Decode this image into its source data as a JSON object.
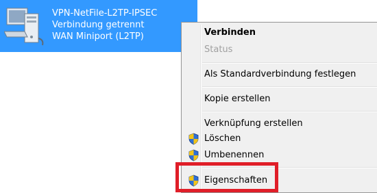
{
  "connection": {
    "name": "VPN-NetFile-L2TP-IPSEC",
    "status": "Verbindung getrennt",
    "device": "WAN Miniport (L2TP)",
    "icon": "network-computer-icon",
    "selected_bg": "#3399ff"
  },
  "context_menu": {
    "items": [
      {
        "label": "Verbinden",
        "style": "default"
      },
      {
        "label": "Status",
        "style": "disabled"
      },
      {
        "label": "Als Standardverbindung festlegen",
        "style": "normal"
      },
      {
        "label": "Kopie erstellen",
        "style": "normal"
      },
      {
        "label": "Verknüpfung erstellen",
        "style": "normal"
      },
      {
        "label": "Löschen",
        "style": "normal",
        "icon": "uac-shield-icon"
      },
      {
        "label": "Umbenennen",
        "style": "normal",
        "icon": "uac-shield-icon"
      },
      {
        "label": "Eigenschaften",
        "style": "normal",
        "icon": "uac-shield-icon",
        "highlighted": true
      }
    ]
  },
  "colors": {
    "highlight_box": "#e01e28",
    "menu_bg": "#f0f0f0",
    "disabled_text": "#a0a0a0"
  }
}
